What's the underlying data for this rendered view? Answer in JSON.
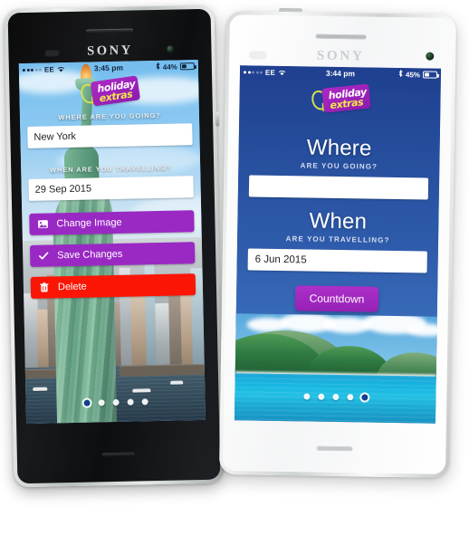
{
  "left_phone": {
    "device_brand": "SONY",
    "statusbar": {
      "signal_dots_total": 5,
      "signal_dots_filled": 3,
      "carrier": "EE",
      "wifi_icon": "wifi-icon",
      "time": "3:45 pm",
      "bluetooth_icon": "bluetooth-icon",
      "battery_text": "44%",
      "battery_level": 44
    },
    "logo": {
      "name": "holiday-extras-logo",
      "line1": "holiday",
      "line2": "extras"
    },
    "form": {
      "where_label": "WHERE ARE YOU GOING?",
      "where_value": "New York",
      "where_placeholder": "Where are you going?",
      "when_label": "WHEN ARE YOU TRAVELLING?",
      "when_value": "29 Sep 2015",
      "when_placeholder": "When are you travelling?"
    },
    "buttons": [
      {
        "label": "Change Image",
        "icon": "image-icon",
        "color": "#9a29c4",
        "name": "change-image-button"
      },
      {
        "label": "Save Changes",
        "icon": "check-icon",
        "color": "#9a29c4",
        "name": "save-changes-button"
      },
      {
        "label": "Delete",
        "icon": "trash-icon",
        "color": "#fa1505",
        "name": "delete-button"
      }
    ],
    "pager": {
      "total": 5,
      "active_index": 0
    },
    "background_image": "statue-of-liberty-new-york-photo"
  },
  "right_phone": {
    "device_brand": "SONY",
    "statusbar": {
      "signal_dots_total": 5,
      "signal_dots_filled": 2,
      "carrier": "EE",
      "wifi_icon": "wifi-icon",
      "time": "3:44 pm",
      "bluetooth_icon": "bluetooth-icon",
      "battery_text": "45%",
      "battery_level": 45
    },
    "logo": {
      "name": "holiday-extras-logo",
      "line1": "holiday",
      "line2": "extras"
    },
    "form": {
      "where_heading": "Where",
      "where_label": "ARE YOU GOING?",
      "where_value": "",
      "where_placeholder": "",
      "when_heading": "When",
      "when_label": "ARE YOU TRAVELLING?",
      "when_value": "6 Jun 2015",
      "when_placeholder": "When are you travelling?"
    },
    "countdown_button": "Countdown",
    "pager": {
      "total": 5,
      "active_index": 4
    },
    "background_image": "tropical-island-beach-photo"
  },
  "colors": {
    "brand_purple": "#9a29c4",
    "delete_red": "#fa1505",
    "screen_blue_top": "#1f3f8f",
    "screen_blue_bottom": "#447cc6",
    "logo_yellow": "#f4e84a"
  }
}
